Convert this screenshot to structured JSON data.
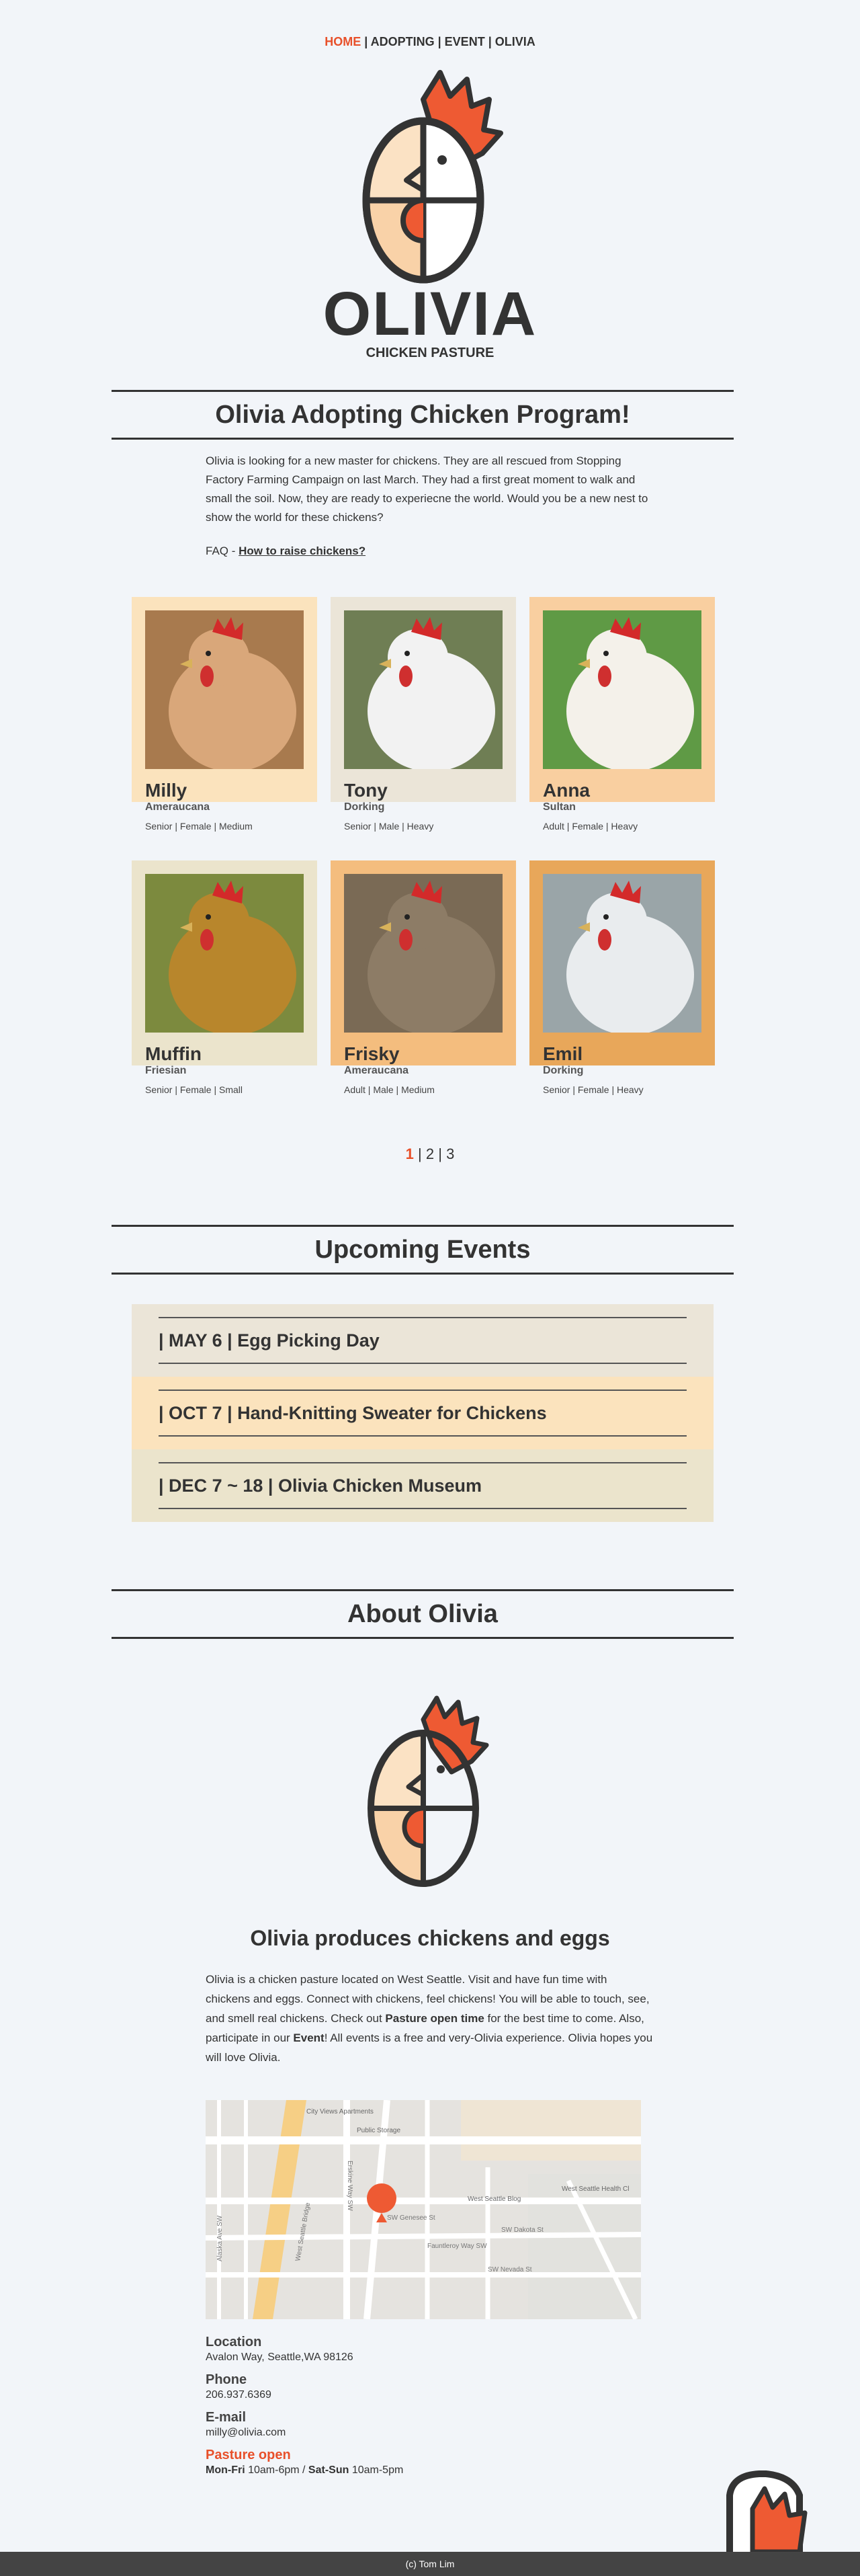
{
  "nav": {
    "items": [
      {
        "label": "HOME",
        "active": true
      },
      {
        "label": "ADOPTING",
        "active": false
      },
      {
        "label": "EVENT",
        "active": false
      },
      {
        "label": "OLIVIA",
        "active": false
      }
    ],
    "separator": " | "
  },
  "logo": {
    "wordmark": "OLIVIA",
    "tagline": "CHICKEN PASTURE"
  },
  "adopt": {
    "title": "Olivia Adopting Chicken Program!",
    "intro": "Olivia is looking for a new master for chickens. They are all rescued from Stopping Factory Farming Campaign on last March. They had a first great moment to walk and small the soil. Now, they are ready to experiecne the world. Would you be a new nest to show the world for these chickens?",
    "faq_prefix": "FAQ - ",
    "faq_link": "How to raise chickens?"
  },
  "chickens": [
    {
      "name": "Milly",
      "breed": "Ameraucana",
      "meta": "Senior | Female | Medium",
      "bg": "#fbe3bd",
      "photo_bg": "#a87a4e",
      "photo_fg": "#d9a77a"
    },
    {
      "name": "Tony",
      "breed": "Dorking",
      "meta": "Senior | Male | Heavy",
      "bg": "#ebe5d8",
      "photo_bg": "#6f7e54",
      "photo_fg": "#f2f2f2"
    },
    {
      "name": "Anna",
      "breed": "Sultan",
      "meta": "Adult | Female | Heavy",
      "bg": "#f9cfa0",
      "photo_bg": "#5f9a45",
      "photo_fg": "#f4f1ea"
    },
    {
      "name": "Muffin",
      "breed": "Friesian",
      "meta": "Senior | Female | Small",
      "bg": "#ebe4cc",
      "photo_bg": "#7c8a3e",
      "photo_fg": "#b8862c"
    },
    {
      "name": "Frisky",
      "breed": "Ameraucana",
      "meta": "Adult | Male | Medium",
      "bg": "#f4bd7e",
      "photo_bg": "#7a6a55",
      "photo_fg": "#8d7c66"
    },
    {
      "name": "Emil",
      "breed": "Dorking",
      "meta": "Senior | Female | Heavy",
      "bg": "#e8a75a",
      "photo_bg": "#9aa5a8",
      "photo_fg": "#e9ecee"
    }
  ],
  "pager": {
    "pages": [
      "1",
      "2",
      "3"
    ],
    "active": "1",
    "separator": " | "
  },
  "events": {
    "title": "Upcoming Events",
    "items": [
      {
        "label": "| MAY 6 | Egg Picking Day",
        "bg": "#ebe5d8"
      },
      {
        "label": "| OCT 7 | Hand-Knitting Sweater for Chickens",
        "bg": "#fbe3bd"
      },
      {
        "label": "| DEC 7 ~ 18 | Olivia Chicken Museum",
        "bg": "#ebe4cc"
      }
    ]
  },
  "about": {
    "title": "About Olivia",
    "heading": "Olivia produces chickens and eggs",
    "text_1": "Olivia is a chicken pasture located on West Seattle. Visit and have fun time with chickens and eggs. Connect with chickens, feel chickens! You will be able to touch, see, and smell real chickens. Check out ",
    "text_bold_1": "Pasture open time",
    "text_2": " for the best time to come. Also, participate in our ",
    "text_bold_2": "Event",
    "text_3": "! All events is a free and very-Olivia experience. Olivia hopes you will love Olivia."
  },
  "map": {
    "labels": [
      "City Views Apartments",
      "Public Storage",
      "West Seattle Blog",
      "West Seattle Health Cl",
      "SW Dakota St",
      "West Seattle Bridge",
      "SW Nevada St",
      "Erskine Way SW",
      "Fauntleroy Way SW",
      "SW Genesee St",
      "Alaska Ave SW"
    ]
  },
  "contact": {
    "location_label": "Location",
    "location_value": "Avalon Way, Seattle,WA 98126",
    "phone_label": "Phone",
    "phone_value": "206.937.6369",
    "email_label": "E-mail",
    "email_value": "milly@olivia.com",
    "open_label": "Pasture open",
    "open_days_1": "Mon-Fri",
    "open_hours_1": " 10am-6pm / ",
    "open_days_2": "Sat-Sun",
    "open_hours_2": " 10am-5pm"
  },
  "footer": {
    "text": "(c) Tom Lim"
  },
  "colors": {
    "accent": "#e8502a",
    "text": "#333333",
    "background": "#f2f5f9",
    "footer": "#444444"
  }
}
